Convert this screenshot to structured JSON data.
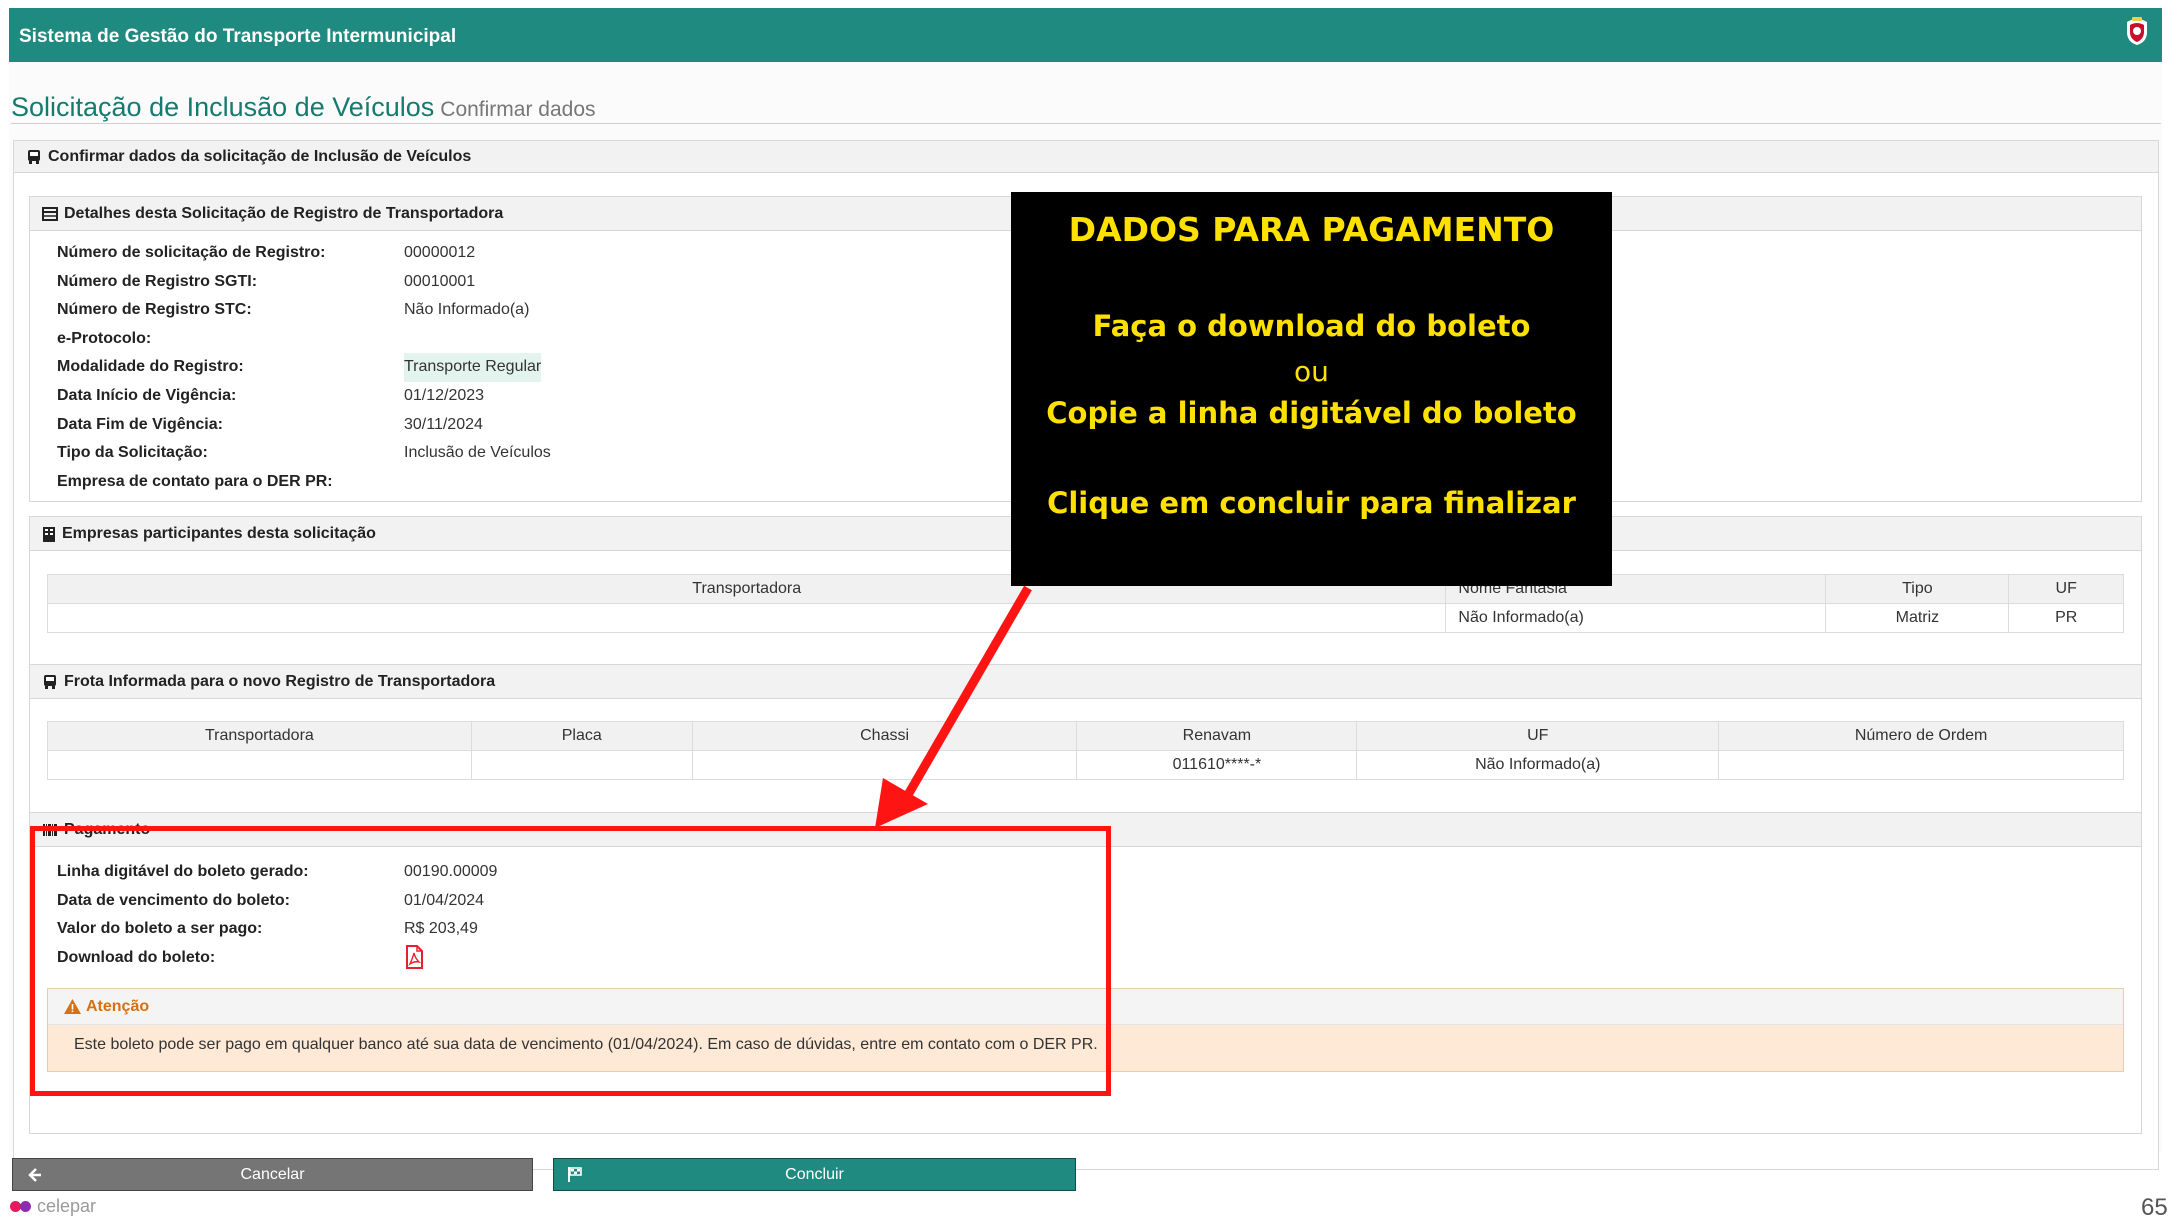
{
  "app": {
    "title": "Sistema de Gestão do Transporte Intermunicipal"
  },
  "page": {
    "title": "Solicitação de Inclusão de Veículos",
    "subtitle": "Confirmar dados"
  },
  "main_panel": {
    "title": "Confirmar dados da solicitação de Inclusão de Veículos"
  },
  "details": {
    "title": "Detalhes desta Solicitação de Registro de Transportadora",
    "rows": [
      {
        "label": "Número de solicitação de Registro:",
        "value": "00000012"
      },
      {
        "label": "Número de Registro SGTI:",
        "value": "00010001"
      },
      {
        "label": "Número de Registro STC:",
        "value": "Não Informado(a)"
      },
      {
        "label": "e-Protocolo:",
        "value": ""
      },
      {
        "label": "Modalidade do Registro:",
        "value": "Transporte Regular"
      },
      {
        "label": "Data Início de Vigência:",
        "value": "01/12/2023"
      },
      {
        "label": "Data Fim de Vigência:",
        "value": "30/11/2024"
      },
      {
        "label": "Tipo da Solicitação:",
        "value": "Inclusão de Veículos"
      },
      {
        "label": "Empresa de contato para o DER PR:",
        "value": ""
      }
    ]
  },
  "empresas": {
    "title": "Empresas participantes desta solicitação",
    "columns": [
      "Transportadora",
      "Nome Fantasia",
      "Tipo",
      "UF"
    ],
    "rows": [
      [
        "",
        "Não Informado(a)",
        "Matriz",
        "PR"
      ]
    ]
  },
  "frota": {
    "title": "Frota Informada para o novo Registro de Transportadora",
    "columns": [
      "Transportadora",
      "Placa",
      "Chassi",
      "Renavam",
      "UF",
      "Número de Ordem"
    ],
    "rows": [
      [
        "",
        "",
        "",
        "011610****-*",
        "Não Informado(a)",
        ""
      ]
    ]
  },
  "pagamento": {
    "title": "Pagamento",
    "rows": [
      {
        "label": "Linha digitável do boleto gerado:",
        "value": "00190.00009"
      },
      {
        "label": "Data de vencimento do boleto:",
        "value": "01/04/2024"
      },
      {
        "label": "Valor do boleto a ser pago:",
        "value": "R$ 203,49"
      },
      {
        "label": "Download do boleto:",
        "value": ""
      }
    ],
    "download_icon": "pdf-icon"
  },
  "alert": {
    "title": "Atenção",
    "text": "Este boleto pode ser pago em qualquer banco até sua data de vencimento (01/04/2024). Em caso de dúvidas, entre em contato com o DER PR."
  },
  "overlay": {
    "heading": "DADOS PARA PAGAMENTO",
    "line1": "Faça o download do boleto",
    "line2": "ou",
    "line3": "Copie a linha digitável do boleto",
    "line4": "Clique em concluir para finalizar"
  },
  "buttons": {
    "cancel": "Cancelar",
    "confirm": "Concluir"
  },
  "footer": {
    "logo": "celepar",
    "page_number": "65"
  },
  "colors": {
    "brand": "#1f8a80",
    "accent": "#d9700f",
    "alert_bg": "#fde9d6",
    "annotation_red": "#ff1414",
    "annotation_text": "#ffe100"
  }
}
